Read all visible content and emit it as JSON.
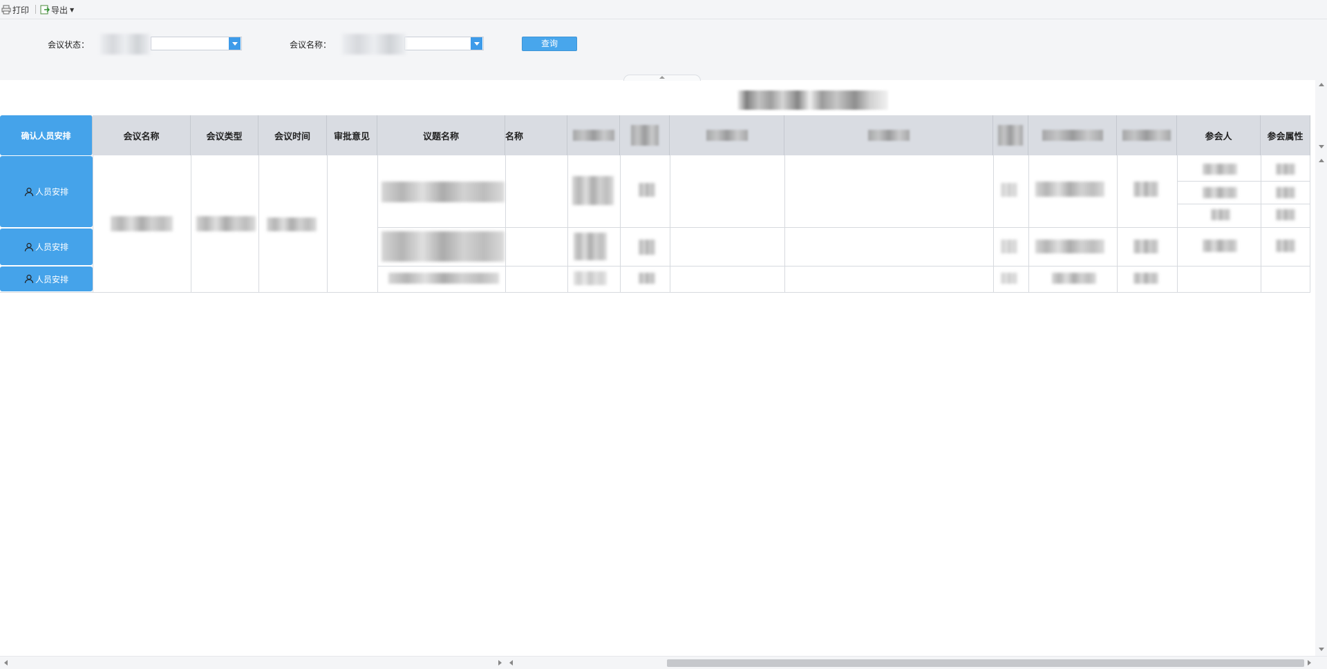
{
  "toolbar": {
    "print_label": "打印",
    "export_label": "导出"
  },
  "filters": {
    "status_label": "会议状态：",
    "name_label": "会议名称：",
    "query_button": "查询"
  },
  "table": {
    "confirm_header": "确认人员安排",
    "columns": [
      "会议名称",
      "会议类型",
      "会议时间",
      "审批意见",
      "议题名称",
      "名称",
      "",
      "",
      "",
      "",
      "",
      "",
      "",
      "参会人",
      "参会属性"
    ],
    "row_button_label": "人员安排"
  },
  "colors": {
    "accent": "#45a3ea",
    "header_bg": "#d9dce2",
    "toolbar_bg": "#f4f5f7"
  }
}
